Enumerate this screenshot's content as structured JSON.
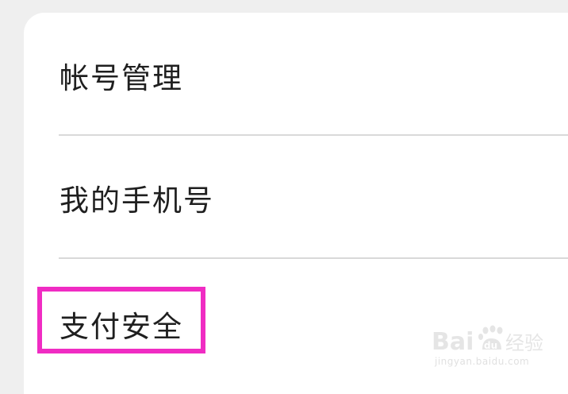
{
  "settings": {
    "items": [
      {
        "label": "帐号管理"
      },
      {
        "label": "我的手机号"
      },
      {
        "label": "支付安全"
      }
    ]
  },
  "highlight": {
    "color": "#f02cc3"
  },
  "watermark": {
    "brand": "Bai",
    "brand_suffix": "du",
    "brand_cn": "经验",
    "url": "jingyan.baidu.com"
  }
}
